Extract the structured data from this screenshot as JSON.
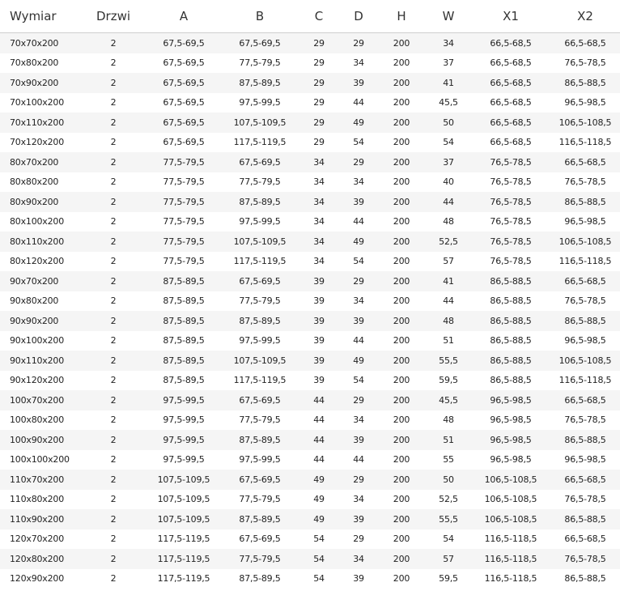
{
  "headers": [
    "Wymiar",
    "Drzwi",
    "A",
    "B",
    "C",
    "D",
    "H",
    "W",
    "X1",
    "X2"
  ],
  "rows": [
    [
      "70x70x200",
      "2",
      "67,5-69,5",
      "67,5-69,5",
      "29",
      "29",
      "200",
      "34",
      "66,5-68,5",
      "66,5-68,5"
    ],
    [
      "70x80x200",
      "2",
      "67,5-69,5",
      "77,5-79,5",
      "29",
      "34",
      "200",
      "37",
      "66,5-68,5",
      "76,5-78,5"
    ],
    [
      "70x90x200",
      "2",
      "67,5-69,5",
      "87,5-89,5",
      "29",
      "39",
      "200",
      "41",
      "66,5-68,5",
      "86,5-88,5"
    ],
    [
      "70x100x200",
      "2",
      "67,5-69,5",
      "97,5-99,5",
      "29",
      "44",
      "200",
      "45,5",
      "66,5-68,5",
      "96,5-98,5"
    ],
    [
      "70x110x200",
      "2",
      "67,5-69,5",
      "107,5-109,5",
      "29",
      "49",
      "200",
      "50",
      "66,5-68,5",
      "106,5-108,5"
    ],
    [
      "70x120x200",
      "2",
      "67,5-69,5",
      "117,5-119,5",
      "29",
      "54",
      "200",
      "54",
      "66,5-68,5",
      "116,5-118,5"
    ],
    [
      "80x70x200",
      "2",
      "77,5-79,5",
      "67,5-69,5",
      "34",
      "29",
      "200",
      "37",
      "76,5-78,5",
      "66,5-68,5"
    ],
    [
      "80x80x200",
      "2",
      "77,5-79,5",
      "77,5-79,5",
      "34",
      "34",
      "200",
      "40",
      "76,5-78,5",
      "76,5-78,5"
    ],
    [
      "80x90x200",
      "2",
      "77,5-79,5",
      "87,5-89,5",
      "34",
      "39",
      "200",
      "44",
      "76,5-78,5",
      "86,5-88,5"
    ],
    [
      "80x100x200",
      "2",
      "77,5-79,5",
      "97,5-99,5",
      "34",
      "44",
      "200",
      "48",
      "76,5-78,5",
      "96,5-98,5"
    ],
    [
      "80x110x200",
      "2",
      "77,5-79,5",
      "107,5-109,5",
      "34",
      "49",
      "200",
      "52,5",
      "76,5-78,5",
      "106,5-108,5"
    ],
    [
      "80x120x200",
      "2",
      "77,5-79,5",
      "117,5-119,5",
      "34",
      "54",
      "200",
      "57",
      "76,5-78,5",
      "116,5-118,5"
    ],
    [
      "90x70x200",
      "2",
      "87,5-89,5",
      "67,5-69,5",
      "39",
      "29",
      "200",
      "41",
      "86,5-88,5",
      "66,5-68,5"
    ],
    [
      "90x80x200",
      "2",
      "87,5-89,5",
      "77,5-79,5",
      "39",
      "34",
      "200",
      "44",
      "86,5-88,5",
      "76,5-78,5"
    ],
    [
      "90x90x200",
      "2",
      "87,5-89,5",
      "87,5-89,5",
      "39",
      "39",
      "200",
      "48",
      "86,5-88,5",
      "86,5-88,5"
    ],
    [
      "90x100x200",
      "2",
      "87,5-89,5",
      "97,5-99,5",
      "39",
      "44",
      "200",
      "51",
      "86,5-88,5",
      "96,5-98,5"
    ],
    [
      "90x110x200",
      "2",
      "87,5-89,5",
      "107,5-109,5",
      "39",
      "49",
      "200",
      "55,5",
      "86,5-88,5",
      "106,5-108,5"
    ],
    [
      "90x120x200",
      "2",
      "87,5-89,5",
      "117,5-119,5",
      "39",
      "54",
      "200",
      "59,5",
      "86,5-88,5",
      "116,5-118,5"
    ],
    [
      "100x70x200",
      "2",
      "97,5-99,5",
      "67,5-69,5",
      "44",
      "29",
      "200",
      "45,5",
      "96,5-98,5",
      "66,5-68,5"
    ],
    [
      "100x80x200",
      "2",
      "97,5-99,5",
      "77,5-79,5",
      "44",
      "34",
      "200",
      "48",
      "96,5-98,5",
      "76,5-78,5"
    ],
    [
      "100x90x200",
      "2",
      "97,5-99,5",
      "87,5-89,5",
      "44",
      "39",
      "200",
      "51",
      "96,5-98,5",
      "86,5-88,5"
    ],
    [
      "100x100x200",
      "2",
      "97,5-99,5",
      "97,5-99,5",
      "44",
      "44",
      "200",
      "55",
      "96,5-98,5",
      "96,5-98,5"
    ],
    [
      "110x70x200",
      "2",
      "107,5-109,5",
      "67,5-69,5",
      "49",
      "29",
      "200",
      "50",
      "106,5-108,5",
      "66,5-68,5"
    ],
    [
      "110x80x200",
      "2",
      "107,5-109,5",
      "77,5-79,5",
      "49",
      "34",
      "200",
      "52,5",
      "106,5-108,5",
      "76,5-78,5"
    ],
    [
      "110x90x200",
      "2",
      "107,5-109,5",
      "87,5-89,5",
      "49",
      "39",
      "200",
      "55,5",
      "106,5-108,5",
      "86,5-88,5"
    ],
    [
      "120x70x200",
      "2",
      "117,5-119,5",
      "67,5-69,5",
      "54",
      "29",
      "200",
      "54",
      "116,5-118,5",
      "66,5-68,5"
    ],
    [
      "120x80x200",
      "2",
      "117,5-119,5",
      "77,5-79,5",
      "54",
      "34",
      "200",
      "57",
      "116,5-118,5",
      "76,5-78,5"
    ],
    [
      "120x90x200",
      "2",
      "117,5-119,5",
      "87,5-89,5",
      "54",
      "39",
      "200",
      "59,5",
      "116,5-118,5",
      "86,5-88,5"
    ]
  ]
}
